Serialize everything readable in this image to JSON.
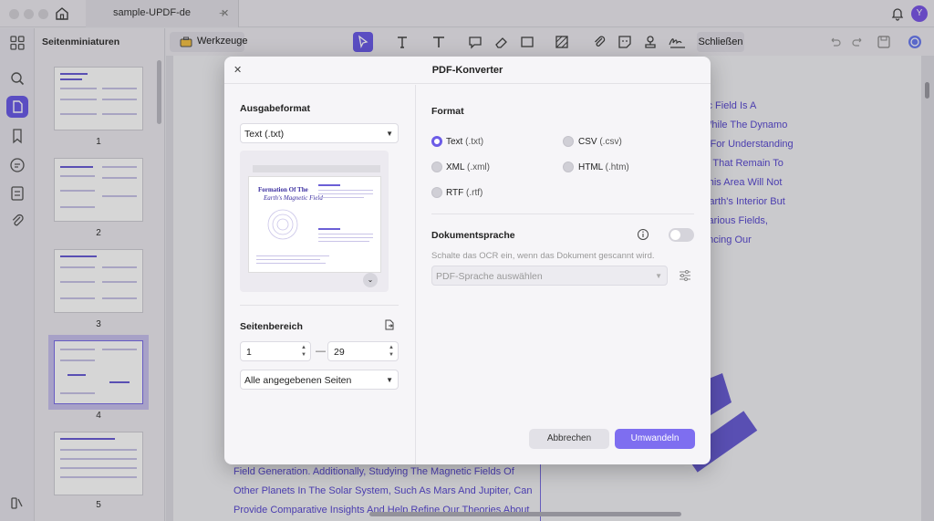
{
  "window": {
    "tab_title": "sample-UPDF-de",
    "avatar_initial": "Y"
  },
  "sidebar": {
    "title": "Seitenminiaturen",
    "thumbnails": [
      {
        "number": "1"
      },
      {
        "number": "2"
      },
      {
        "number": "3"
      },
      {
        "number": "4"
      },
      {
        "number": "5"
      }
    ]
  },
  "toolbar": {
    "tools_label": "Werkzeuge",
    "close_label": "Schließen"
  },
  "document": {
    "right_lines": [
      "tic Field Is A",
      "While The Dynamo",
      "k For Understanding",
      "ts That Remain To",
      "This Area Will Not",
      "Earth's Interior But",
      "Various Fields,",
      "ancing Our"
    ],
    "bottom_lines": [
      "Field Generation. Additionally, Studying The Magnetic Fields Of",
      "Other Planets In The Solar System, Such As Mars And Jupiter, Can",
      "Provide Comparative Insights And Help Refine Our Theories About"
    ]
  },
  "dialog": {
    "title": "PDF-Konverter",
    "output_format_label": "Ausgabeformat",
    "output_format_value": "Text (.txt)",
    "preview": {
      "title": "Formation Of The",
      "subtitle": "Earth's Magnetic Field"
    },
    "page_range_label": "Seitenbereich",
    "range_from": "1",
    "range_to": "29",
    "pages_dropdown": "Alle angegebenen Seiten",
    "format_label": "Format",
    "formats": [
      {
        "name": "Text",
        "ext": "(.txt)",
        "selected": true
      },
      {
        "name": "CSV",
        "ext": "(.csv)",
        "selected": false
      },
      {
        "name": "XML",
        "ext": "(.xml)",
        "selected": false
      },
      {
        "name": "HTML",
        "ext": "(.htm)",
        "selected": false
      },
      {
        "name": "RTF",
        "ext": "(.rtf)",
        "selected": false
      }
    ],
    "language_label": "Dokumentsprache",
    "ocr_toggle_on": false,
    "ocr_hint": "Schalte das OCR ein, wenn das Dokument gescannt wird.",
    "language_placeholder": "PDF-Sprache auswählen",
    "cancel_label": "Abbrechen",
    "convert_label": "Umwandeln"
  },
  "colors": {
    "accent": "#6c5ce7",
    "primary_button": "#7e6ef0",
    "doc_text": "#5a4ad1"
  }
}
